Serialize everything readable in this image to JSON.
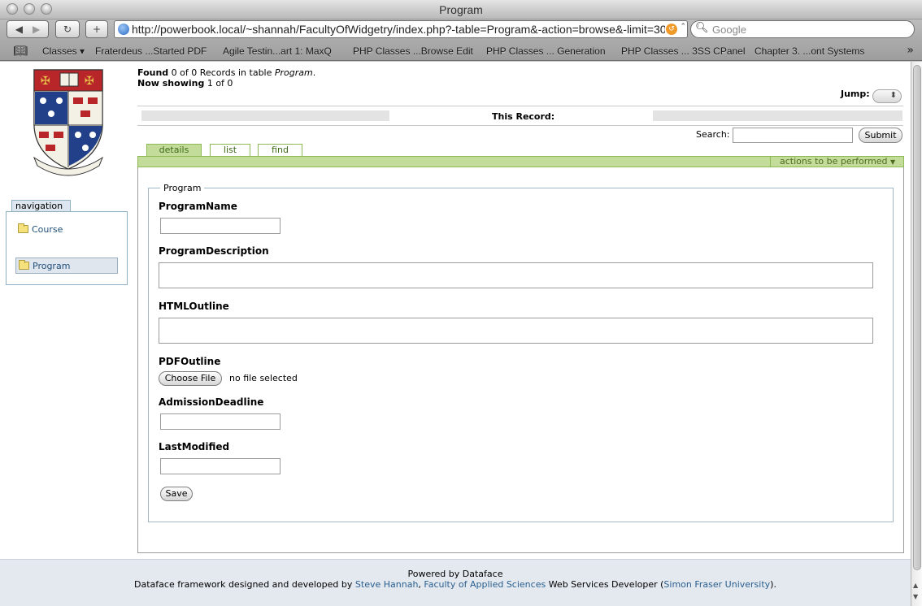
{
  "window": {
    "title": "Program"
  },
  "toolbar": {
    "url": "http://powerbook.local/~shannah/FacultyOfWidgetry/index.php?-table=Program&-action=browse&-limit=30&-",
    "search_placeholder": "Google"
  },
  "bookmarks": [
    "Classes ▾",
    "Fraterdeus ...Started PDF",
    "Agile Testin...art 1: MaxQ",
    "PHP Classes ...Browse Edit",
    "PHP Classes ... Generation",
    "PHP Classes ... 3SS CPanel",
    "Chapter 3. ...ont Systems"
  ],
  "header": {
    "found_label": "Found",
    "found_text": " 0 of 0 Records in table ",
    "table_name": "Program",
    "found_end": ".",
    "showing_label": "Now showing",
    "showing_text": " 1 of 0",
    "jump_label": "Jump:",
    "this_record": "This Record:",
    "search_label": "Search:",
    "submit_label": "Submit"
  },
  "navigation": {
    "title": "navigation",
    "items": [
      {
        "label": "Course"
      },
      {
        "label": "Program"
      }
    ]
  },
  "tabs": [
    "details",
    "list",
    "find"
  ],
  "actions_label": "actions to be performed",
  "form": {
    "legend": "Program",
    "fields": {
      "program_name": "ProgramName",
      "program_description": "ProgramDescription",
      "html_outline": "HTMLOutline",
      "pdf_outline": "PDFOutline",
      "admission_deadline": "AdmissionDeadline",
      "last_modified": "LastModified"
    },
    "choose_file": "Choose File",
    "no_file": "no file selected",
    "save": "Save"
  },
  "footer": {
    "powered": "Powered by Dataface",
    "line2_a": "Dataface framework designed and developed by ",
    "author": "Steve Hannah",
    "line2_b": ", ",
    "faculty": "Faculty of Applied Sciences",
    "line2_c": " Web Services Developer (",
    "university": "Simon Fraser University",
    "line2_d": ")."
  },
  "colors": {
    "tab_green": "#c3dc99",
    "tab_border": "#8dba55",
    "nav_border": "#8fb0c2",
    "link_blue": "#2a5f8f"
  }
}
